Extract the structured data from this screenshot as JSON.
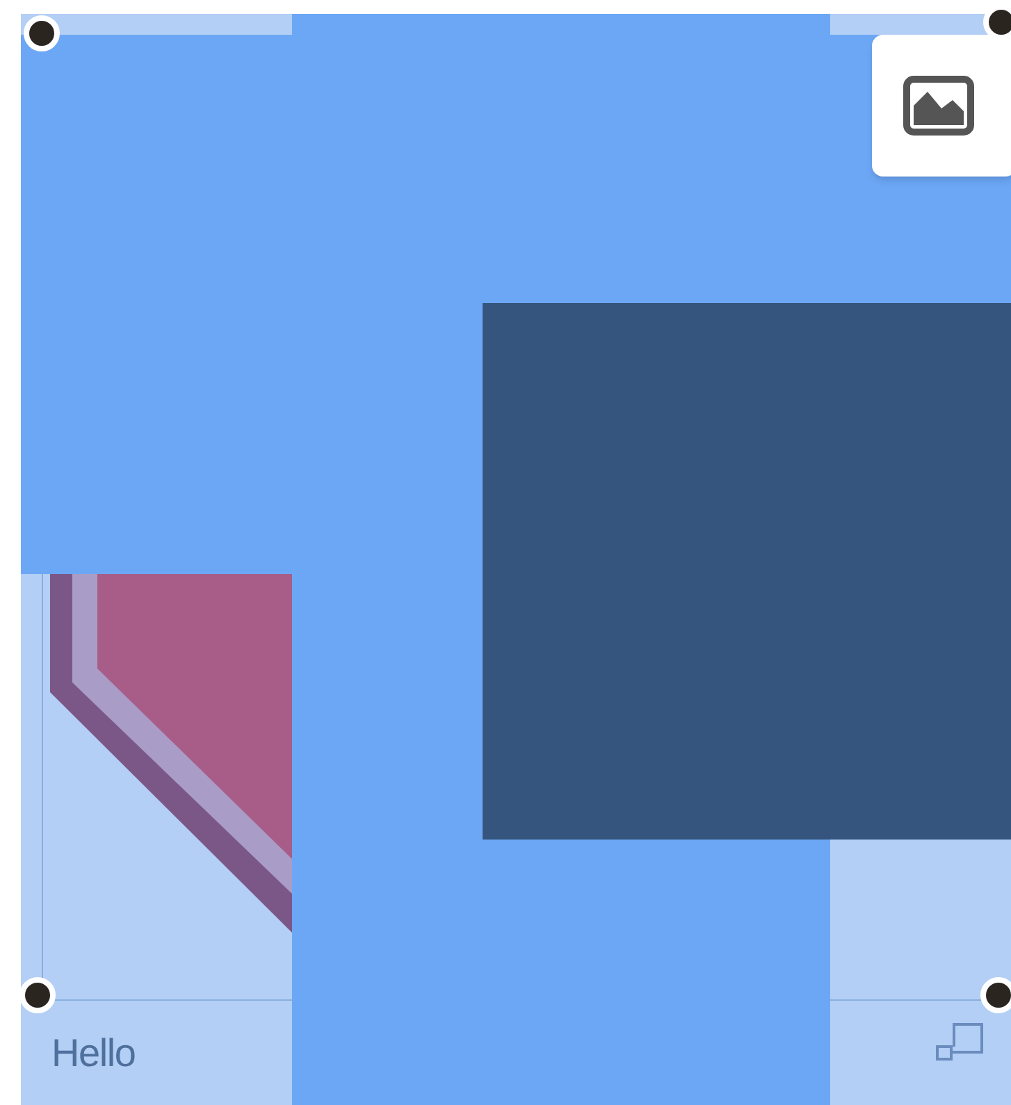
{
  "caption": "Hello"
}
